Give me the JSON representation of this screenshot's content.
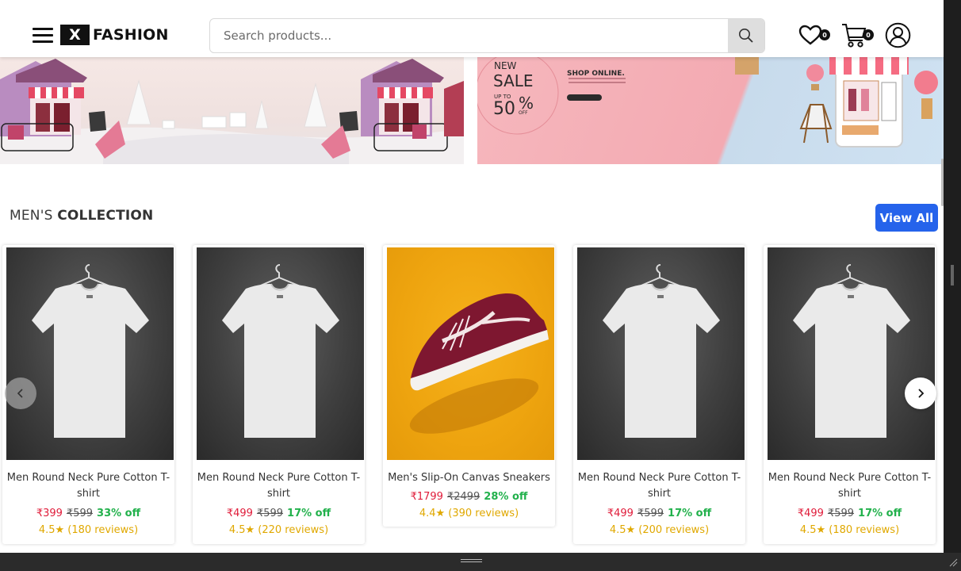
{
  "header": {
    "logo_mark": "X",
    "logo_text": "FASHION",
    "search_placeholder": "Search products...",
    "wishlist_count": "0",
    "cart_count": "0"
  },
  "banners": {
    "right": {
      "new": "NEW",
      "sale": "SALE",
      "upto": "UP TO",
      "fifty": "50",
      "percent": "%",
      "off": "OFF",
      "shop_online": "SHOP ONLINE."
    }
  },
  "section": {
    "title_part1": "MEN'S",
    "title_part2": "COLLECTION",
    "view_all": "View All"
  },
  "products": [
    {
      "name": "Men Round Neck Pure Cotton T-shirt",
      "price": "₹399",
      "original": "₹599",
      "discount": "33% off",
      "rating": "4.5★ (180 reviews)",
      "image": "tshirt"
    },
    {
      "name": "Men Round Neck Pure Cotton T-shirt",
      "price": "₹499",
      "original": "₹599",
      "discount": "17% off",
      "rating": "4.5★ (220 reviews)",
      "image": "tshirt"
    },
    {
      "name": "Men's Slip-On Canvas Sneakers",
      "price": "₹1799",
      "original": "₹2499",
      "discount": "28% off",
      "rating": "4.4★ (390 reviews)",
      "image": "sneaker"
    },
    {
      "name": "Men Round Neck Pure Cotton T-shirt",
      "price": "₹499",
      "original": "₹599",
      "discount": "17% off",
      "rating": "4.5★ (200 reviews)",
      "image": "tshirt"
    },
    {
      "name": "Men Round Neck Pure Cotton T-shirt",
      "price": "₹499",
      "original": "₹599",
      "discount": "17% off",
      "rating": "4.5★ (180 reviews)",
      "image": "tshirt"
    }
  ],
  "colors": {
    "accent": "#2563eb",
    "price": "#e01c3a",
    "discount": "#22b14c",
    "rating": "#e0a800"
  },
  "icons": {
    "menu": "hamburger-icon",
    "search": "search-icon",
    "wishlist": "heart-icon",
    "cart": "cart-icon",
    "account": "user-icon",
    "prev": "chevron-left-icon",
    "next": "chevron-right-icon"
  }
}
